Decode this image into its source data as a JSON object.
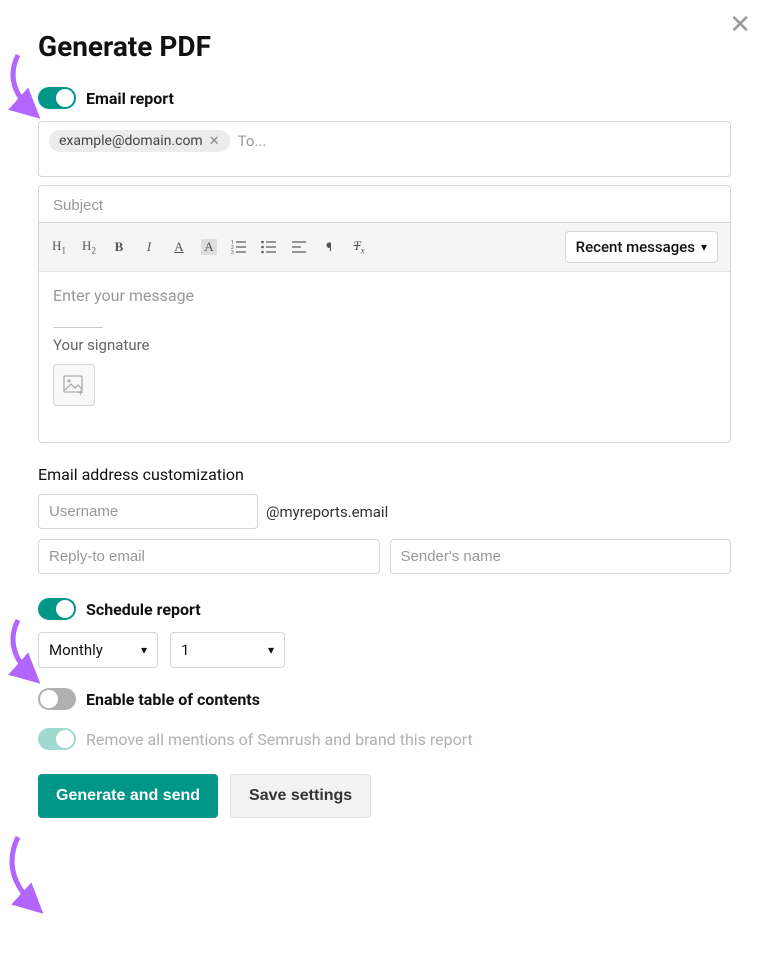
{
  "title": "Generate PDF",
  "email_report_toggle_label": "Email report",
  "to": {
    "chip_email": "example@domain.com",
    "placeholder": "To..."
  },
  "subject": {
    "placeholder": "Subject"
  },
  "recent_messages_label": "Recent messages",
  "editor_placeholder": "Enter your message",
  "signature_label": "Your signature",
  "email_customization_label": "Email address customization",
  "username_placeholder": "Username",
  "domain_suffix": "@myreports.email",
  "reply_to_placeholder": "Reply-to email",
  "sender_name_placeholder": "Sender's name",
  "schedule_report_label": "Schedule report",
  "schedule_frequency": "Monthly",
  "schedule_day": "1",
  "toc_label": "Enable table of contents",
  "branding_label": "Remove all mentions of Semrush and brand this report",
  "generate_button": "Generate and send",
  "save_button": "Save settings"
}
